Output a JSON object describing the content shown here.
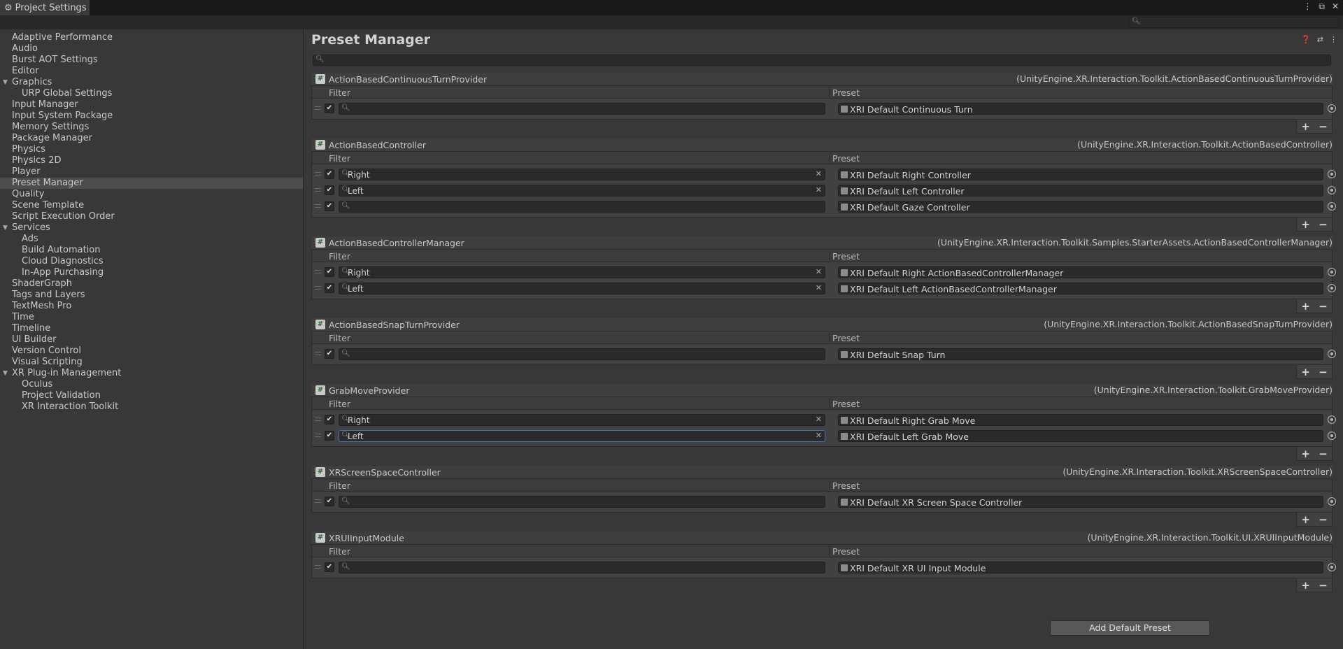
{
  "window": {
    "tab_title": "Project Settings",
    "controls": [
      "⋮",
      "⧉",
      "✕"
    ]
  },
  "sidebar": {
    "items": [
      {
        "label": "Adaptive Performance",
        "level": 0
      },
      {
        "label": "Audio",
        "level": 0
      },
      {
        "label": "Burst AOT Settings",
        "level": 0
      },
      {
        "label": "Editor",
        "level": 0
      },
      {
        "label": "Graphics",
        "level": 0,
        "expanded": true
      },
      {
        "label": "URP Global Settings",
        "level": 1
      },
      {
        "label": "Input Manager",
        "level": 0
      },
      {
        "label": "Input System Package",
        "level": 0
      },
      {
        "label": "Memory Settings",
        "level": 0
      },
      {
        "label": "Package Manager",
        "level": 0
      },
      {
        "label": "Physics",
        "level": 0
      },
      {
        "label": "Physics 2D",
        "level": 0
      },
      {
        "label": "Player",
        "level": 0
      },
      {
        "label": "Preset Manager",
        "level": 0,
        "selected": true
      },
      {
        "label": "Quality",
        "level": 0
      },
      {
        "label": "Scene Template",
        "level": 0
      },
      {
        "label": "Script Execution Order",
        "level": 0
      },
      {
        "label": "Services",
        "level": 0,
        "expanded": true
      },
      {
        "label": "Ads",
        "level": 1
      },
      {
        "label": "Build Automation",
        "level": 1
      },
      {
        "label": "Cloud Diagnostics",
        "level": 1
      },
      {
        "label": "In-App Purchasing",
        "level": 1
      },
      {
        "label": "ShaderGraph",
        "level": 0
      },
      {
        "label": "Tags and Layers",
        "level": 0
      },
      {
        "label": "TextMesh Pro",
        "level": 0
      },
      {
        "label": "Time",
        "level": 0
      },
      {
        "label": "Timeline",
        "level": 0
      },
      {
        "label": "UI Builder",
        "level": 0
      },
      {
        "label": "Version Control",
        "level": 0
      },
      {
        "label": "Visual Scripting",
        "level": 0
      },
      {
        "label": "XR Plug-in Management",
        "level": 0,
        "expanded": true
      },
      {
        "label": "Oculus",
        "level": 1
      },
      {
        "label": "Project Validation",
        "level": 1
      },
      {
        "label": "XR Interaction Toolkit",
        "level": 1
      }
    ]
  },
  "main": {
    "title": "Preset Manager",
    "filter_col": "Filter",
    "preset_col": "Preset",
    "add_default_label": "Add Default Preset",
    "groups": [
      {
        "name": "ActionBasedContinuousTurnProvider",
        "full": "(UnityEngine.XR.Interaction.Toolkit.ActionBasedContinuousTurnProvider)",
        "rows": [
          {
            "filter": "",
            "preset": "XRI Default Continuous Turn"
          }
        ]
      },
      {
        "name": "ActionBasedController",
        "full": "(UnityEngine.XR.Interaction.Toolkit.ActionBasedController)",
        "rows": [
          {
            "filter": "Right",
            "preset": "XRI Default Right Controller"
          },
          {
            "filter": "Left",
            "preset": "XRI Default Left Controller"
          },
          {
            "filter": "",
            "preset": "XRI Default Gaze Controller"
          }
        ]
      },
      {
        "name": "ActionBasedControllerManager",
        "full": "(UnityEngine.XR.Interaction.Toolkit.Samples.StarterAssets.ActionBasedControllerManager)",
        "rows": [
          {
            "filter": "Right",
            "preset": "XRI Default Right ActionBasedControllerManager"
          },
          {
            "filter": "Left",
            "preset": "XRI Default Left ActionBasedControllerManager"
          }
        ]
      },
      {
        "name": "ActionBasedSnapTurnProvider",
        "full": "(UnityEngine.XR.Interaction.Toolkit.ActionBasedSnapTurnProvider)",
        "rows": [
          {
            "filter": "",
            "preset": "XRI Default Snap Turn"
          }
        ]
      },
      {
        "name": "GrabMoveProvider",
        "full": "(UnityEngine.XR.Interaction.Toolkit.GrabMoveProvider)",
        "rows": [
          {
            "filter": "Right",
            "preset": "XRI Default Right Grab Move"
          },
          {
            "filter": "Left",
            "preset": "XRI Default Left Grab Move",
            "focused": true
          }
        ]
      },
      {
        "name": "XRScreenSpaceController",
        "full": "(UnityEngine.XR.Interaction.Toolkit.XRScreenSpaceController)",
        "rows": [
          {
            "filter": "",
            "preset": "XRI Default XR Screen Space Controller"
          }
        ]
      },
      {
        "name": "XRUIInputModule",
        "full": "(UnityEngine.XR.Interaction.Toolkit.UI.XRUIInputModule)",
        "rows": [
          {
            "filter": "",
            "preset": "XRI Default XR UI Input Module"
          }
        ]
      }
    ]
  },
  "colors": {
    "background": "#383838",
    "selected_row": "#4d4d4d",
    "focus_border": "#3a79bb"
  }
}
